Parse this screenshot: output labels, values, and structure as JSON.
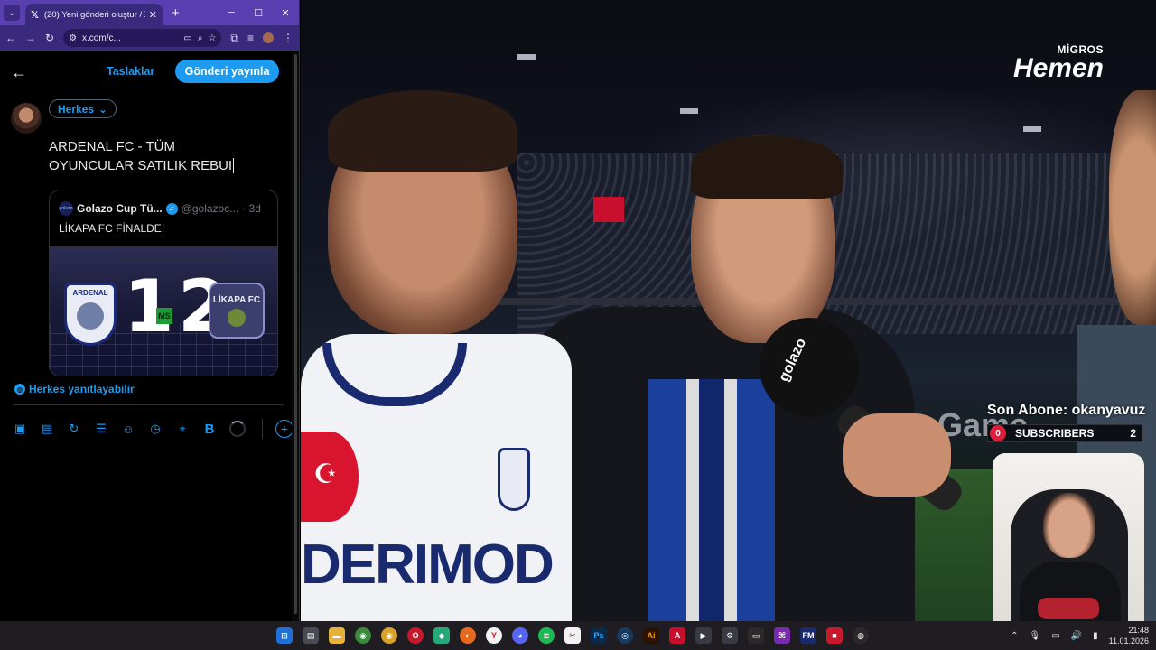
{
  "browser": {
    "tab_title": "(20) Yeni gönderi oluştur / X",
    "url": "x.com/c...",
    "new_tab": "+",
    "tab_close": "✕"
  },
  "compose": {
    "drafts_label": "Taslaklar",
    "post_button": "Gönderi yayınla",
    "audience": "Herkes",
    "text_line1": "ARDENAL FC - TÜM",
    "text_line2": "OYUNCULAR SATILIK REBUI",
    "reply_setting": "Herkes yanıtlayabilir"
  },
  "quote": {
    "name": "Golazo Cup Tü...",
    "handle": "@golazoc...",
    "time": "· 3d",
    "text": "LİKAPA FC FİNALDE!",
    "logo_text": "golazo",
    "media": {
      "team_left": "ARDENAL",
      "score_left": "1",
      "divider": "MS",
      "score_right": "2",
      "team_right": "LİKAPA FC"
    }
  },
  "video": {
    "sponsor_top": "MİGROS",
    "sponsor_main": "Hemen",
    "mic_label": "golazo",
    "jersey_sponsor": "DERIMOD",
    "banner_text": "Game",
    "last_sub_label": "Son Abone: okanyavuz",
    "sub_count": "0",
    "sub_text": "SUBSCRIBERS",
    "sub_goal": "2"
  },
  "taskbar": {
    "time": "21:48",
    "date": "11.01.2026",
    "apps": [
      "windows",
      "files",
      "folder",
      "chrome",
      "chrome-2",
      "opera",
      "app-green",
      "firefox",
      "yandex",
      "discord",
      "spotify",
      "capcut",
      "photoshop",
      "steam",
      "illustrator",
      "acrobat",
      "camera",
      "settings",
      "cmd",
      "app-purple",
      "fm",
      "video",
      "obs"
    ]
  },
  "colors": {
    "accent": "#1d9bf0",
    "browser_frame": "#3a2a7e",
    "sub_badge": "#e01e3c"
  }
}
